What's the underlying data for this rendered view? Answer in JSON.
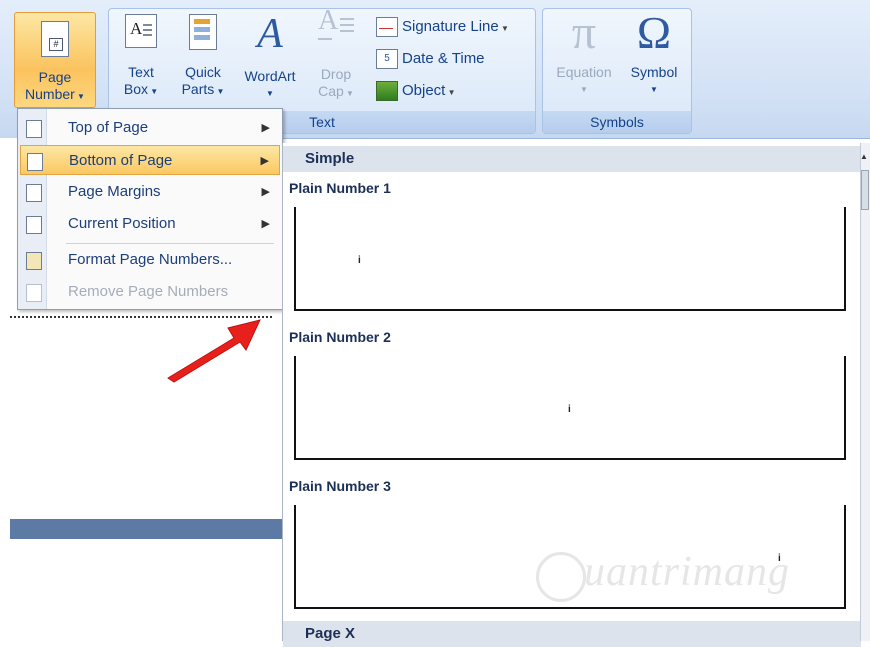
{
  "ribbon": {
    "page_number": {
      "line1": "Page",
      "line2": "Number"
    },
    "text_box": {
      "line1": "Text",
      "line2": "Box"
    },
    "quick_parts": {
      "line1": "Quick",
      "line2": "Parts"
    },
    "wordart": {
      "line1": "WordArt"
    },
    "drop_cap": {
      "line1": "Drop",
      "line2": "Cap"
    },
    "signature_line": "Signature Line",
    "date_time": "Date & Time",
    "object": "Object",
    "text_group_label": "Text",
    "equation": "Equation",
    "symbol": "Symbol",
    "symbols_group_label": "Symbols",
    "pi_glyph": "π",
    "omega_glyph": "Ω"
  },
  "menu": {
    "items": [
      {
        "label": "Top of Page",
        "icon": "page-top-icon"
      },
      {
        "label": "Bottom of Page",
        "icon": "page-bottom-icon"
      },
      {
        "label": "Page Margins",
        "icon": "page-margins-icon"
      },
      {
        "label": "Current Position",
        "icon": "current-position-icon"
      },
      {
        "label": "Format Page Numbers...",
        "icon": "format-page-numbers-icon"
      },
      {
        "label": "Remove Page Numbers",
        "icon": "remove-page-numbers-icon"
      }
    ]
  },
  "gallery": {
    "section_simple": "Simple",
    "items": [
      {
        "title": "Plain Number 1",
        "sample": "i"
      },
      {
        "title": "Plain Number 2",
        "sample": "i"
      },
      {
        "title": "Plain Number 3",
        "sample": "i"
      }
    ],
    "section_page_x": "Page X"
  },
  "watermark": "uantrimang",
  "colors": {
    "ribbon_bg": "#d2e1f5",
    "highlight": "#fbc862",
    "arrow": "#e8201b",
    "doc_bar": "#5d7aa5"
  }
}
